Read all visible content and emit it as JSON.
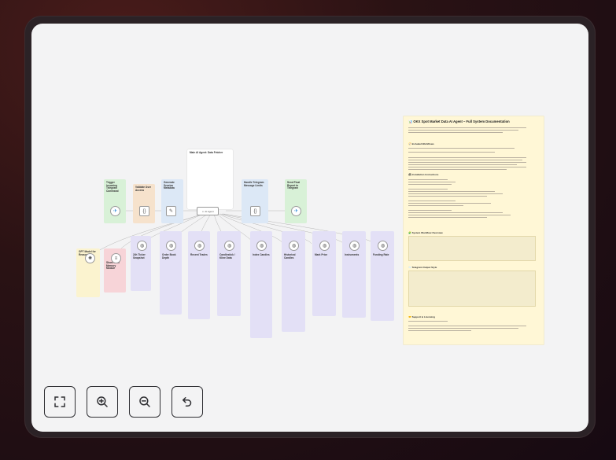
{
  "workflow": {
    "header_notes": [
      {
        "title": "Trigger Incoming Telegram Command"
      },
      {
        "title": "Validate User Access"
      },
      {
        "title": "Generate Session Metadata"
      },
      {
        "title": "Main AI Agent: Data Fetcher"
      },
      {
        "title": "Handle Telegram Message Limits"
      },
      {
        "title": "Send Final Report to Telegram"
      }
    ],
    "memory_notes": [
      {
        "title": "GPT Model for Reasoning"
      },
      {
        "title": "Short-Term Memory Module"
      }
    ],
    "tool_notes": [
      {
        "title": "24h Ticker Snapshot"
      },
      {
        "title": "Order Book Depth"
      },
      {
        "title": "Recent Trades"
      },
      {
        "title": "Candlestick / Kline Data"
      },
      {
        "title": "Index Candles"
      },
      {
        "title": "Historical Candles"
      },
      {
        "title": "Mark Price"
      },
      {
        "title": "Instruments"
      },
      {
        "title": "Funding Rate"
      }
    ],
    "node_labels": {
      "agent": "AI Agent"
    }
  },
  "documentation": {
    "title": "📊 OKX Spot Market Data AI Agent – Full System Documentation",
    "sections": [
      "🧭 Included Workflows",
      "🛠 Installation Instructions",
      "🧩 System Workflow Overview",
      "📨 Telegram Output Style",
      "🤝 Support & Licensing"
    ]
  },
  "toolbar": {
    "buttons": [
      {
        "name": "fit-view-button",
        "icon": "fullscreen-icon"
      },
      {
        "name": "zoom-in-button",
        "icon": "zoom-in-icon"
      },
      {
        "name": "zoom-out-button",
        "icon": "zoom-out-icon"
      },
      {
        "name": "reset-zoom-button",
        "icon": "undo-icon"
      }
    ]
  },
  "colors": {
    "green_note": "#d8f1d7",
    "orange_note": "#f6e2cc",
    "blue_note": "#dce8f6",
    "yellow_note": "#fbf3cf",
    "pink_note": "#f7d4d8",
    "purple_note": "#e3e0f6",
    "doc_note": "#fff7d6"
  }
}
